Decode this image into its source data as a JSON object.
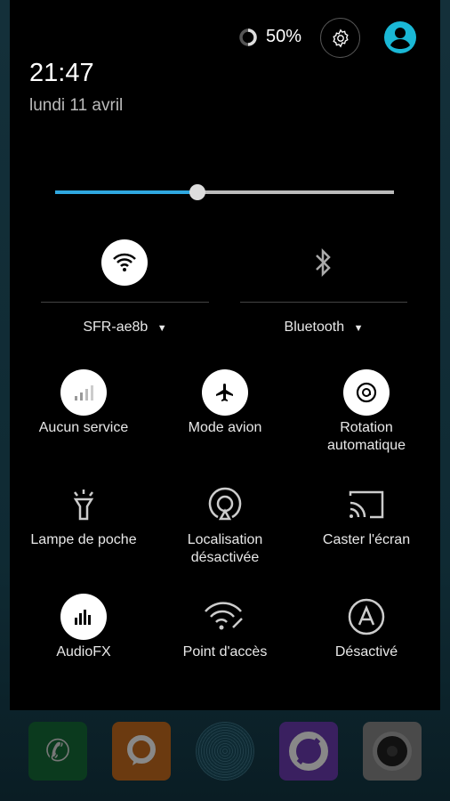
{
  "status": {
    "battery": "50%",
    "time": "21:47",
    "date": "lundi 11 avril"
  },
  "brightness": {
    "level": 0.42,
    "accent": "#2fa8e0"
  },
  "wifi": {
    "label": "SFR-ae8b",
    "active": true
  },
  "bluetooth": {
    "label": "Bluetooth",
    "active": false
  },
  "tiles": [
    {
      "label": "Aucun service",
      "icon": "signal-icon",
      "active": true
    },
    {
      "label": "Mode avion",
      "icon": "airplane-icon",
      "active": true
    },
    {
      "label": "Rotation automatique",
      "icon": "auto-rotate-icon",
      "active": true
    },
    {
      "label": "Lampe de poche",
      "icon": "flashlight-icon",
      "active": false
    },
    {
      "label": "Localisation désactivée",
      "icon": "location-icon",
      "active": false
    },
    {
      "label": "Caster l'écran",
      "icon": "cast-icon",
      "active": false
    },
    {
      "label": "AudioFX",
      "icon": "equalizer-icon",
      "active": true
    },
    {
      "label": "Point d'accès",
      "icon": "hotspot-icon",
      "active": false
    },
    {
      "label": "Désactivé",
      "icon": "data-saver-icon",
      "active": false
    }
  ],
  "colors": {
    "avatar": "#1ab8d6"
  }
}
